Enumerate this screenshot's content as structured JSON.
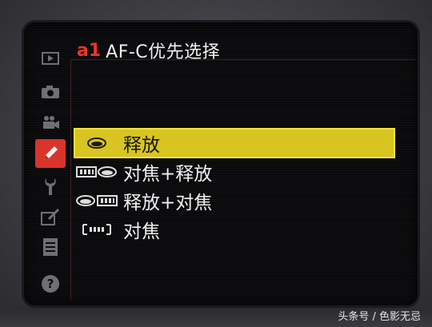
{
  "header": {
    "code": "a1",
    "title": "AF-C优先选择"
  },
  "sidebar": {
    "items": [
      {
        "icon": "playback-icon"
      },
      {
        "icon": "camera-icon"
      },
      {
        "icon": "movie-camera-icon"
      },
      {
        "icon": "pencil-icon",
        "active": true
      },
      {
        "icon": "wrench-icon"
      },
      {
        "icon": "retouch-icon"
      },
      {
        "icon": "list-icon"
      },
      {
        "icon": "help-icon"
      }
    ]
  },
  "options": [
    {
      "label": "释放",
      "icon": "release-icon",
      "selected": true
    },
    {
      "label": "对焦+释放",
      "icon": "focus-release-icon"
    },
    {
      "label": "释放+对焦",
      "icon": "release-focus-icon"
    },
    {
      "label": "对焦",
      "icon": "focus-icon"
    }
  ],
  "watermark": {
    "text": "头条号 / 色影无忌"
  },
  "colors": {
    "accent_red": "#d8322a",
    "selected_yellow": "#d8c41f"
  }
}
